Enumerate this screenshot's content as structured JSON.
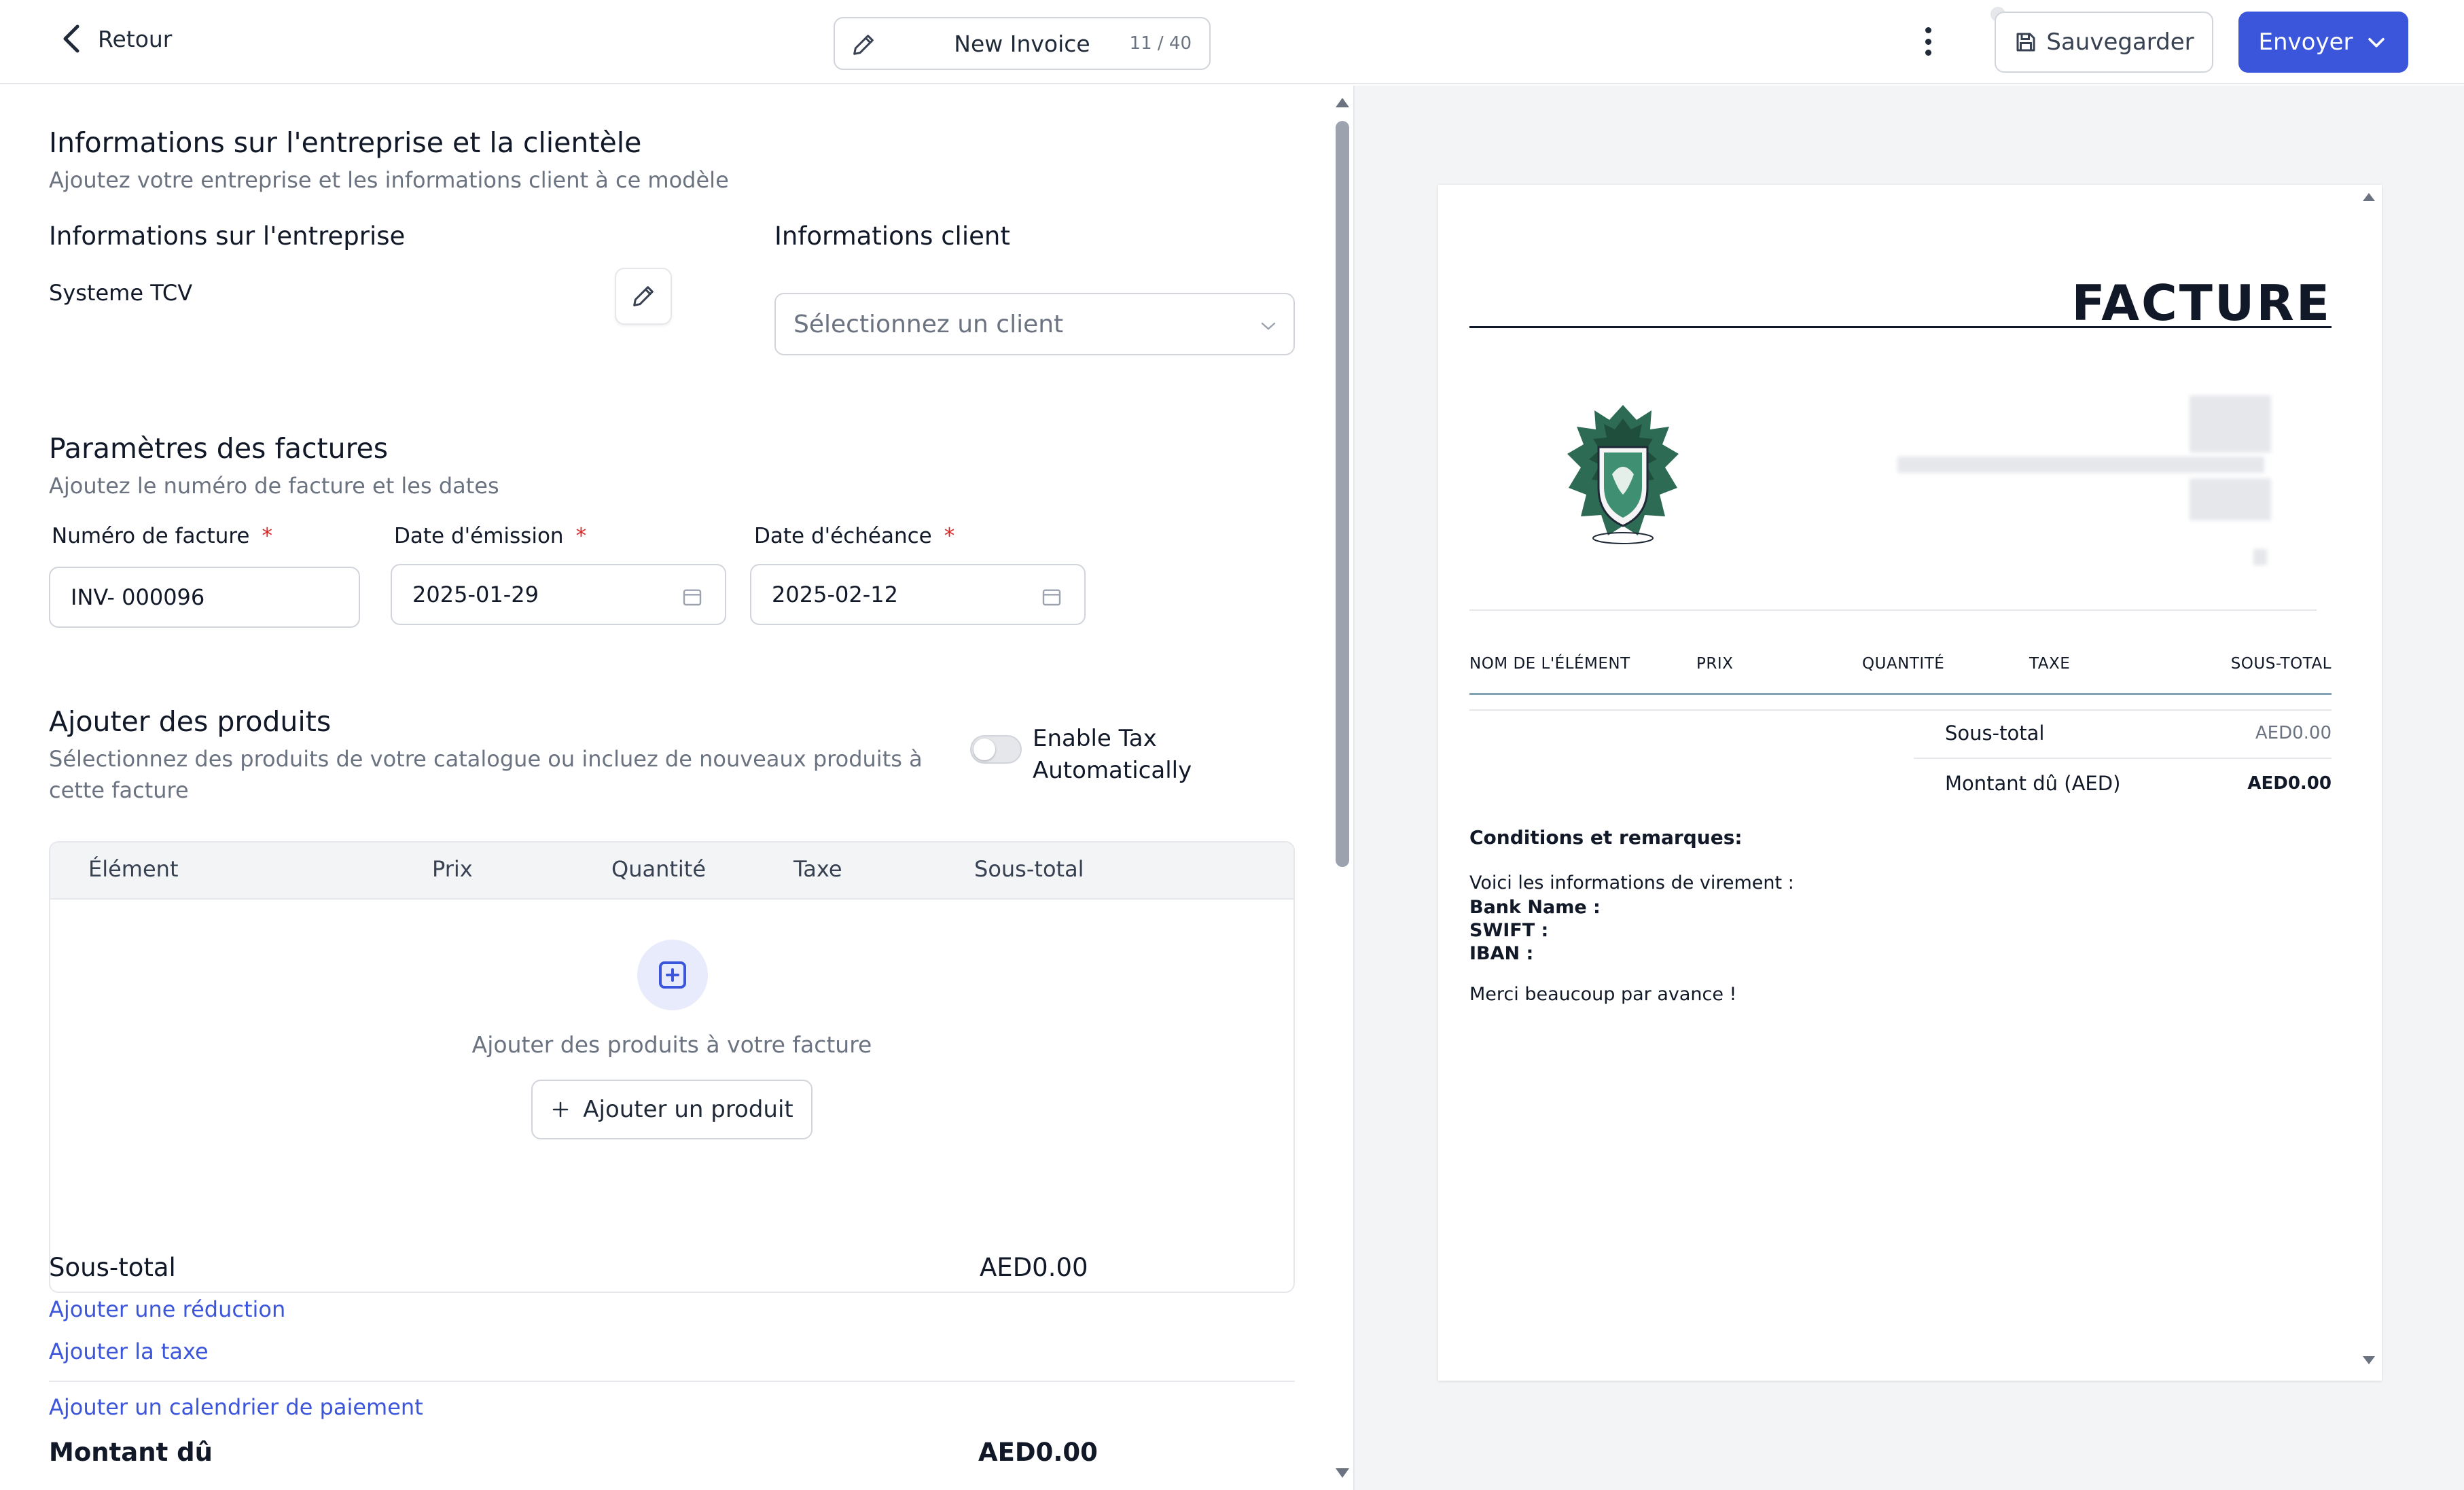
{
  "header": {
    "back_label": "Retour",
    "doc_title": "New Invoice",
    "title_count": "11 / 40",
    "save_label": "Sauvegarder",
    "send_label": "Envoyer"
  },
  "company_client": {
    "title": "Informations sur l'entreprise et la clientèle",
    "subtitle": "Ajoutez votre entreprise et les informations client à ce modèle",
    "company_label": "Informations sur l'entreprise",
    "company_name": "Systeme TCV",
    "client_label": "Informations client",
    "client_placeholder": "Sélectionnez un client"
  },
  "invoice_params": {
    "title": "Paramètres des factures",
    "subtitle": "Ajoutez le numéro de facture et les dates",
    "number_label": "Numéro de facture",
    "number_value": "INV- 000096",
    "issue_label": "Date d'émission",
    "issue_value": "2025-01-29",
    "due_label": "Date d'échéance",
    "due_value": "2025-02-12",
    "required_mark": "*"
  },
  "products": {
    "title": "Ajouter des produits",
    "subtitle": "Sélectionnez des produits de votre catalogue ou incluez de nouveaux produits à cette facture",
    "toggle_label": "Enable Tax Automatically",
    "toggle_on": false,
    "columns": [
      "Élément",
      "Prix",
      "Quantité",
      "Taxe",
      "Sous-total"
    ],
    "empty_text": "Ajouter des produits à votre facture",
    "add_button": "Ajouter un produit"
  },
  "totals": {
    "subtotal_label": "Sous-total",
    "subtotal_value": "AED0.00",
    "add_discount": "Ajouter une réduction",
    "add_tax": "Ajouter la taxe",
    "add_schedule": "Ajouter un calendrier de paiement",
    "due_label": "Montant dû",
    "due_value": "AED0.00"
  },
  "preview": {
    "title": "FACTURE",
    "columns": [
      "NOM DE L'ÉLÉMENT",
      "PRIX",
      "QUANTITÉ",
      "TAXE",
      "SOUS-TOTAL"
    ],
    "subtotal_label": "Sous-total",
    "subtotal_value": "AED0.00",
    "due_label": "Montant dû (AED)",
    "due_value": "AED0.00",
    "notes_title": "Conditions et remarques:",
    "notes_intro": "Voici les informations de virement :",
    "bank_name": "Bank Name :",
    "swift": "SWIFT :",
    "iban": "IBAN :",
    "thanks": "Merci beaucoup par avance !"
  },
  "colors": {
    "accent": "#3b55db",
    "required": "#dc2626",
    "crest_green": "#2e6b55"
  }
}
